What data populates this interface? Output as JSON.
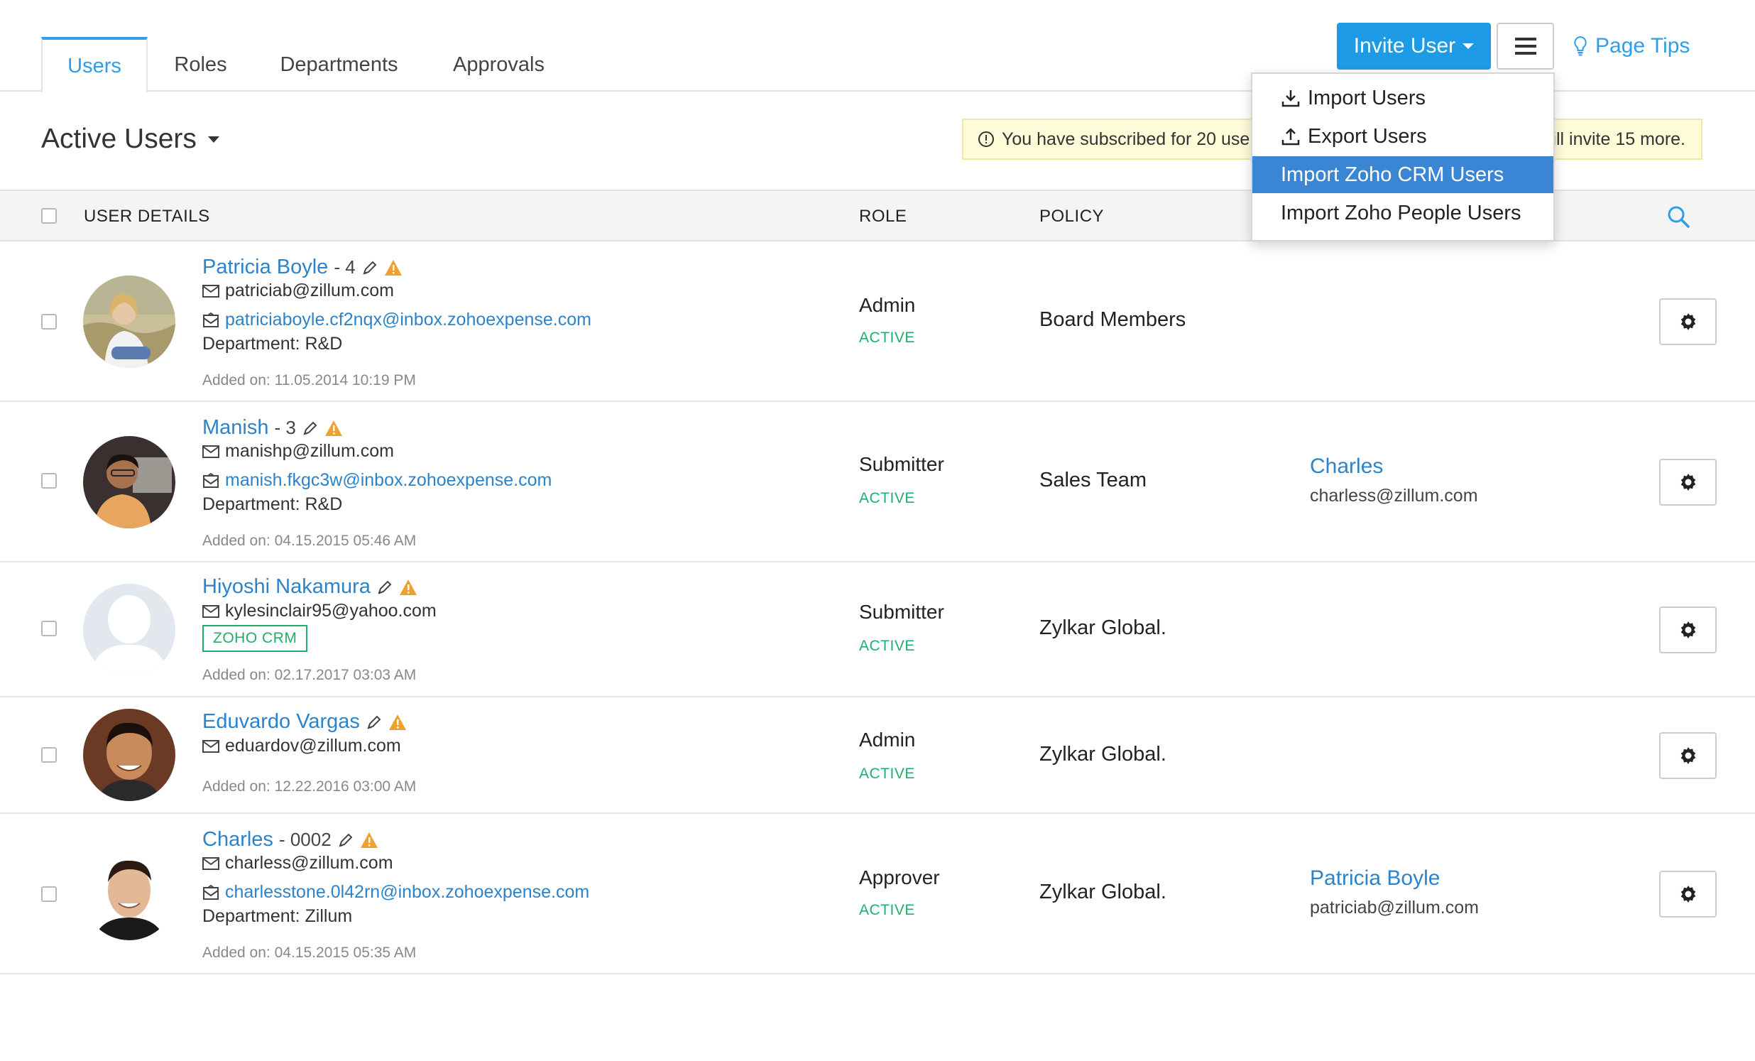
{
  "tabs": [
    {
      "label": "Users",
      "active": true
    },
    {
      "label": "Roles",
      "active": false
    },
    {
      "label": "Departments",
      "active": false
    },
    {
      "label": "Approvals",
      "active": false
    }
  ],
  "toolbar": {
    "invite_label": "Invite User",
    "page_tips_label": "Page Tips"
  },
  "dropdown": {
    "items": [
      {
        "label": "Import Users",
        "icon": "download-icon"
      },
      {
        "label": "Export Users",
        "icon": "upload-icon"
      },
      {
        "label": "Import Zoho CRM Users",
        "highlighted": true
      },
      {
        "label": "Import Zoho People Users"
      }
    ]
  },
  "heading": {
    "view_label": "Active Users"
  },
  "notice": {
    "text_start": "You have subscribed for 20 use",
    "text_end": "ill invite 15 more."
  },
  "table": {
    "headers": {
      "user_details": "USER DETAILS",
      "role": "ROLE",
      "policy": "POLICY"
    }
  },
  "users": [
    {
      "name": "Patricia Boyle",
      "id": "- 4",
      "email": "patriciab@zillum.com",
      "inbox": "patriciaboyle.cf2nqx@inbox.zohoexpense.com",
      "department": "Department: R&D",
      "added": "Added on: 11.05.2014 10:19 PM",
      "role": "Admin",
      "status": "ACTIVE",
      "policy": "Board Members"
    },
    {
      "name": "Manish",
      "id": "- 3",
      "email": "manishp@zillum.com",
      "inbox": "manish.fkgc3w@inbox.zohoexpense.com",
      "department": "Department: R&D",
      "added": "Added on: 04.15.2015 05:46 AM",
      "role": "Submitter",
      "status": "ACTIVE",
      "policy": "Sales Team",
      "approver_name": "Charles",
      "approver_email": "charless@zillum.com"
    },
    {
      "name": "Hiyoshi Nakamura",
      "email": "kylesinclair95@yahoo.com",
      "badge": "ZOHO CRM",
      "added": "Added on: 02.17.2017 03:03 AM",
      "role": "Submitter",
      "status": "ACTIVE",
      "policy": "Zylkar Global."
    },
    {
      "name": "Eduvardo Vargas",
      "email": "eduardov@zillum.com",
      "added": "Added on: 12.22.2016 03:00 AM",
      "role": "Admin",
      "status": "ACTIVE",
      "policy": "Zylkar Global."
    },
    {
      "name": "Charles",
      "id": "- 0002",
      "email": "charless@zillum.com",
      "inbox": "charlesstone.0l42rn@inbox.zohoexpense.com",
      "department": "Department: Zillum",
      "added": "Added on: 04.15.2015 05:35 AM",
      "role": "Approver",
      "status": "ACTIVE",
      "policy": "Zylkar Global.",
      "approver_name": "Patricia Boyle",
      "approver_email": "patriciab@zillum.com"
    }
  ],
  "colors": {
    "accent": "#1e9be6",
    "link": "#2d83c9",
    "active_status": "#1fae6e",
    "warning": "#f0a030",
    "highlight": "#3a86d4"
  }
}
